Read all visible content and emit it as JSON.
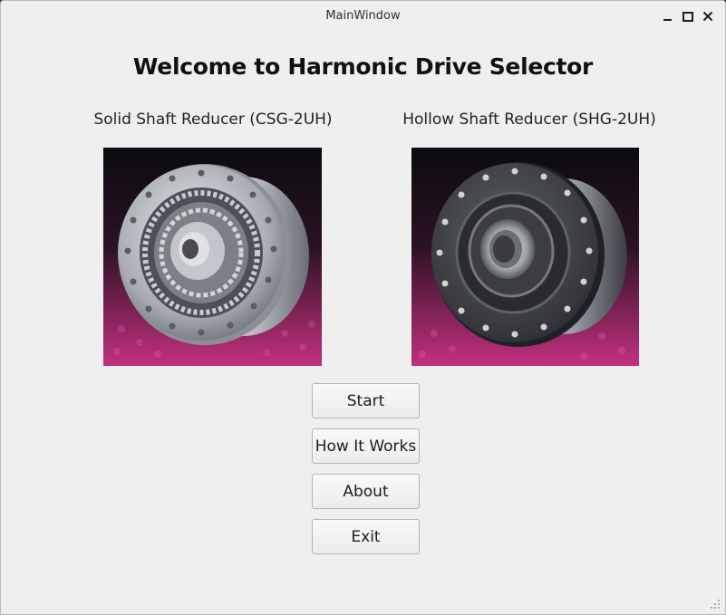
{
  "window": {
    "title": "MainWindow",
    "controls": {
      "minimize": "minimize-icon",
      "maximize": "maximize-icon",
      "close": "close-icon"
    }
  },
  "main": {
    "heading": "Welcome to Harmonic Drive Selector",
    "products": [
      {
        "label": "Solid Shaft Reducer (CSG-2UH)"
      },
      {
        "label": "Hollow Shaft Reducer (SHG-2UH)"
      }
    ],
    "buttons": {
      "start": "Start",
      "how_it_works": "How It Works",
      "about": "About",
      "exit": "Exit"
    }
  },
  "colors": {
    "window_bg": "#efefef",
    "photo_bg_top": "#0b0b10",
    "photo_bg_bottom": "#c2307e"
  }
}
